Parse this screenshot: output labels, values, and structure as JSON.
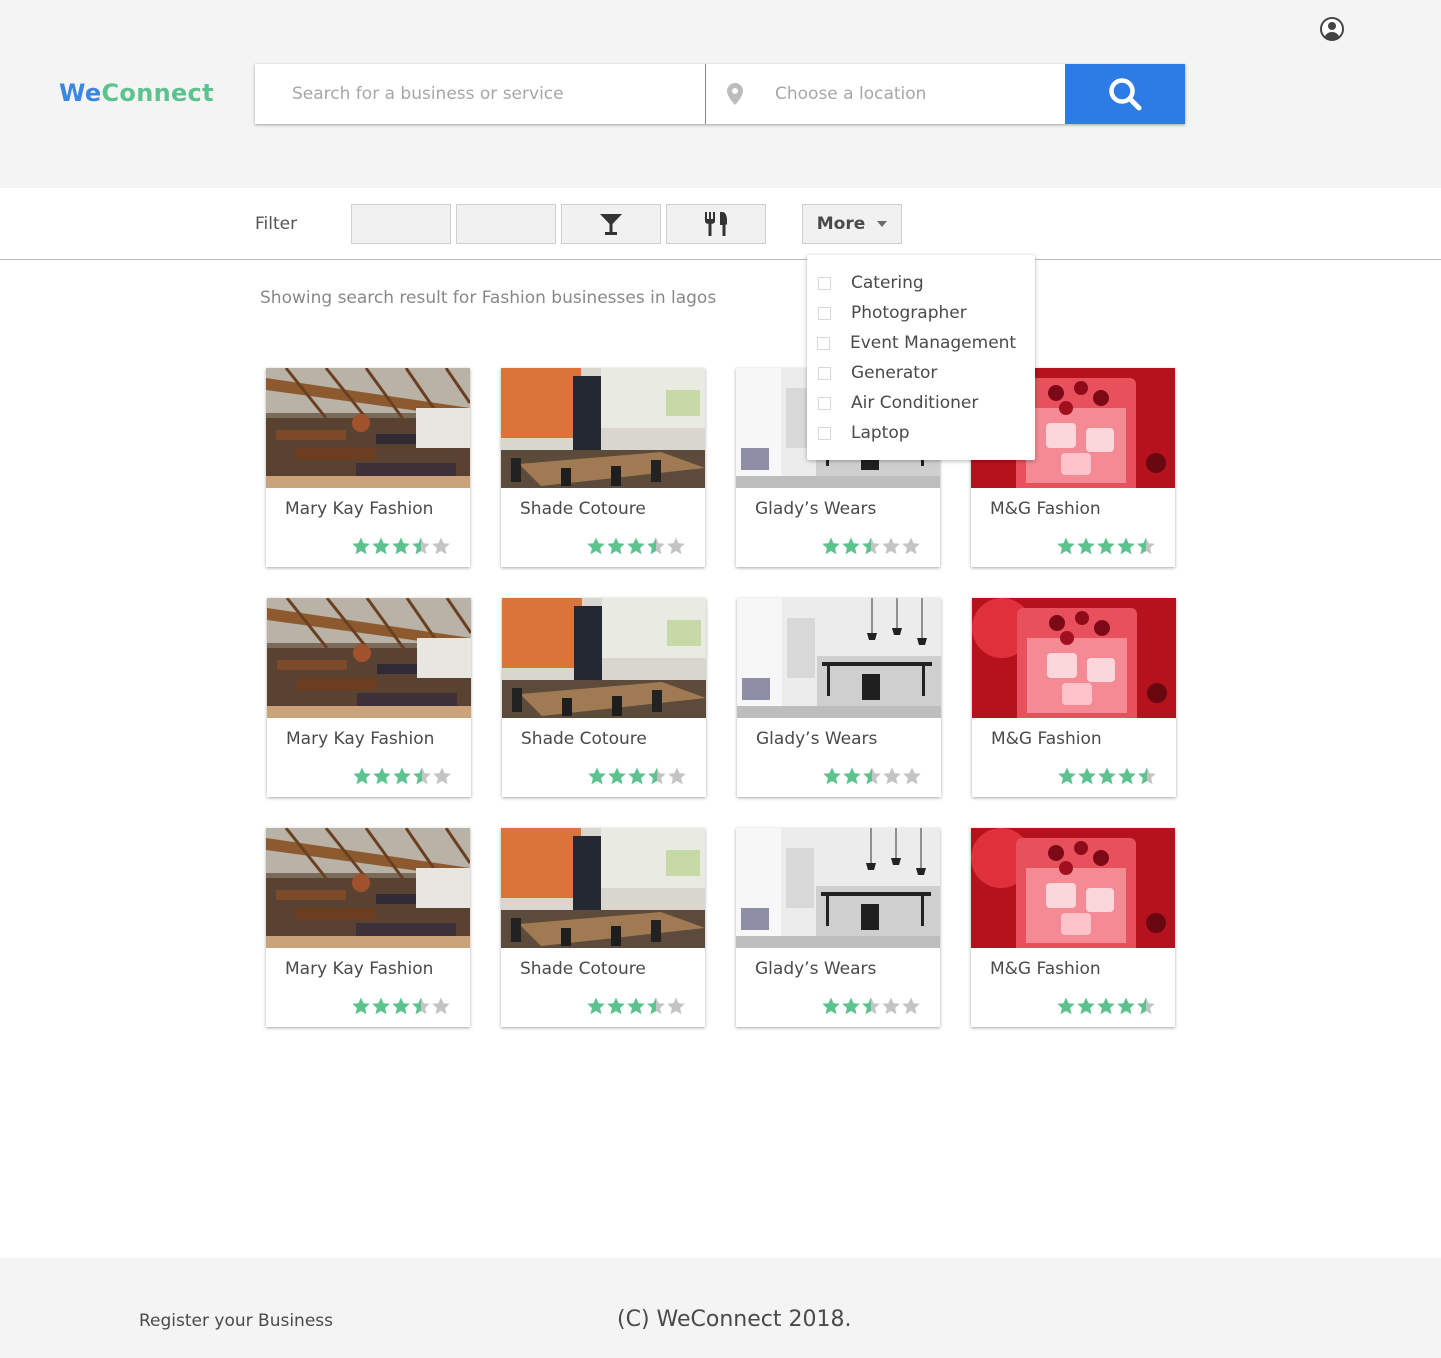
{
  "brand": {
    "we": "We",
    "connect": "Connect",
    "we_color": "#3a86e0",
    "connect_color": "#5cc38f"
  },
  "header": {
    "user_icon": "user-circle-icon",
    "search": {
      "business_placeholder": "Search for a business or service",
      "location_icon": "map-pin-icon",
      "location_placeholder": "Choose a location",
      "button_icon": "search-icon",
      "button_color": "#2d7be5"
    }
  },
  "filter": {
    "label": "Filter",
    "buttons": [
      {
        "icon": ""
      },
      {
        "icon": ""
      },
      {
        "icon": "cocktail-glass-icon"
      },
      {
        "icon": "fork-knife-icon"
      }
    ],
    "more_label": "More",
    "more_options": [
      {
        "label": "Catering",
        "checked": false
      },
      {
        "label": "Photographer",
        "checked": false
      },
      {
        "label": "Event Management",
        "checked": false
      },
      {
        "label": "Generator",
        "checked": false
      },
      {
        "label": "Air Conditioner",
        "checked": false
      },
      {
        "label": "Laptop",
        "checked": false
      }
    ]
  },
  "results": {
    "caption": "Showing search result for Fashion businesses in lagos",
    "star_color": "#5cc38f",
    "cards": [
      {
        "name": "Mary Kay Fashion",
        "rating": 3.5,
        "image": "restaurant-photo"
      },
      {
        "name": "Shade Cotoure",
        "rating": 3.5,
        "image": "conference-room-photo"
      },
      {
        "name": "Glady’s Wears",
        "rating": 2.5,
        "image": "white-office-photo"
      },
      {
        "name": "M&G  Fashion",
        "rating": 4.5,
        "image": "red-drink-photo"
      },
      {
        "name": "Mary Kay Fashion",
        "rating": 3.5,
        "image": "restaurant-photo"
      },
      {
        "name": "Shade Cotoure",
        "rating": 3.5,
        "image": "conference-room-photo"
      },
      {
        "name": "Glady’s Wears",
        "rating": 2.5,
        "image": "white-office-photo"
      },
      {
        "name": "M&G  Fashion",
        "rating": 4.5,
        "image": "red-drink-photo"
      },
      {
        "name": "Mary Kay Fashion",
        "rating": 3.5,
        "image": "restaurant-photo"
      },
      {
        "name": "Shade Cotoure",
        "rating": 3.5,
        "image": "conference-room-photo"
      },
      {
        "name": "Glady’s Wears",
        "rating": 2.5,
        "image": "white-office-photo"
      },
      {
        "name": "M&G  Fashion",
        "rating": 4.5,
        "image": "red-drink-photo"
      }
    ]
  },
  "footer": {
    "register_label": "Register your Business",
    "copyright": "(C) WeConnect 2018."
  }
}
